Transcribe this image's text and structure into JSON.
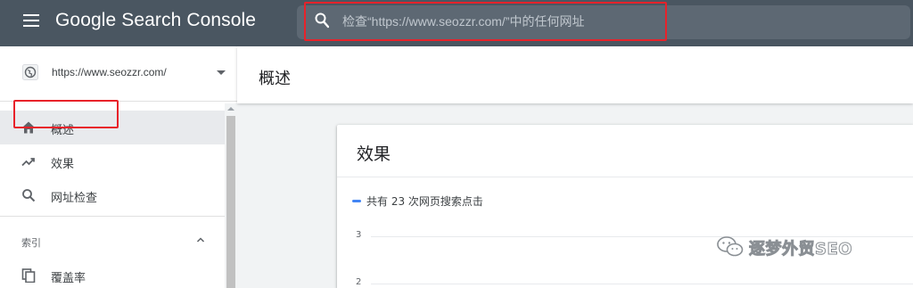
{
  "app": {
    "title": "Google Search Console"
  },
  "search": {
    "placeholder": "检查“https://www.seozzr.com/”中的任何网址"
  },
  "property": {
    "url": "https://www.seozzr.com/"
  },
  "sidebar": {
    "items": [
      {
        "label": "概述",
        "icon": "home-icon",
        "active": true
      },
      {
        "label": "效果",
        "icon": "trending-up-icon",
        "active": false
      },
      {
        "label": "网址检查",
        "icon": "search-icon",
        "active": false
      }
    ],
    "section": {
      "label": "索引",
      "items": [
        {
          "label": "覆盖率",
          "icon": "copy-icon"
        }
      ]
    }
  },
  "main": {
    "title": "概述",
    "card": {
      "title": "效果",
      "legend": "共有 23 次网页搜索点击",
      "y_ticks": [
        "3",
        "2"
      ]
    }
  },
  "watermark": {
    "text": "逐梦外贸SEO"
  },
  "colors": {
    "topbar": "#4a5661",
    "highlight": "#e8222a",
    "series": "#4285f4"
  }
}
